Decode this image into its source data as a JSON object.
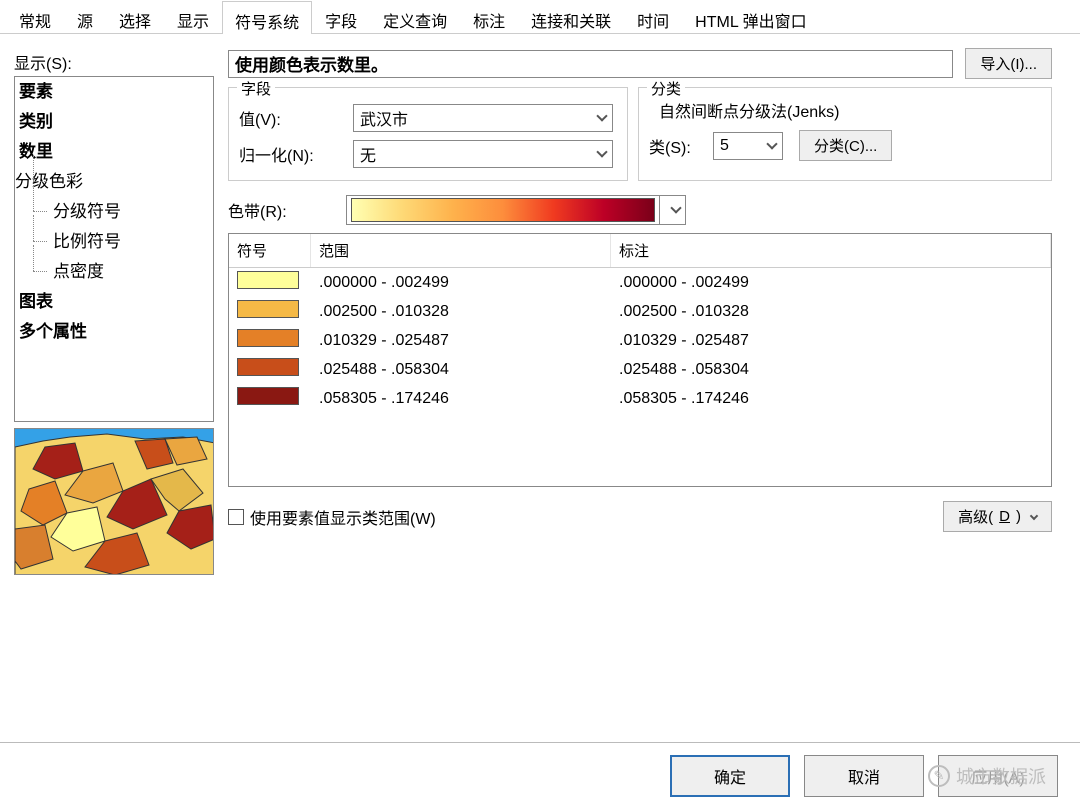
{
  "tabs": [
    "常规",
    "源",
    "选择",
    "显示",
    "符号系统",
    "字段",
    "定义查询",
    "标注",
    "连接和关联",
    "时间",
    "HTML 弹出窗口"
  ],
  "active_tab_index": 4,
  "left": {
    "show_label": "显示(S):",
    "items_root1": "要素",
    "items_root2": "类别",
    "items_root3": "数里",
    "sub1": "分级色彩",
    "sub2": "分级符号",
    "sub3": "比例符号",
    "sub4": "点密度",
    "items_root4": "图表",
    "items_root5": "多个属性"
  },
  "title_text": "使用颜色表示数里。",
  "import_btn": "导入(I)...",
  "field_fieldset": {
    "legend": "字段",
    "value_label": "值(V):",
    "value": "武汉市",
    "norm_label": "归一化(N):",
    "norm": "无"
  },
  "class_fieldset": {
    "legend": "分类",
    "method": "自然间断点分级法(Jenks)",
    "classes_label": "类(S):",
    "classes": "5",
    "classify_btn": "分类(C)..."
  },
  "ramp_label": "色带(R):",
  "class_table": {
    "h_symbol": "符号",
    "h_range": "范围",
    "h_label": "标注",
    "rows": [
      {
        "color": "#ffff9a",
        "range": ".000000 - .002499",
        "label": ".000000 - .002499"
      },
      {
        "color": "#f5b946",
        "range": ".002500 - .010328",
        "label": ".002500 - .010328"
      },
      {
        "color": "#e48027",
        "range": ".010329 - .025487",
        "label": ".010329 - .025487"
      },
      {
        "color": "#c84e1a",
        "range": ".025488 - .058304",
        "label": ".025488 - .058304"
      },
      {
        "color": "#8a1812",
        "range": ".058305 - .174246",
        "label": ".058305 - .174246"
      }
    ]
  },
  "show_feat_check": "使用要素值显示类范围(W)",
  "advanced_btn_pre": "高级(",
  "advanced_btn_u": "D",
  "advanced_btn_post": ")",
  "footer": {
    "ok": "确定",
    "cancel": "取消",
    "apply": "应用(A)"
  },
  "watermark": "城市数据派"
}
